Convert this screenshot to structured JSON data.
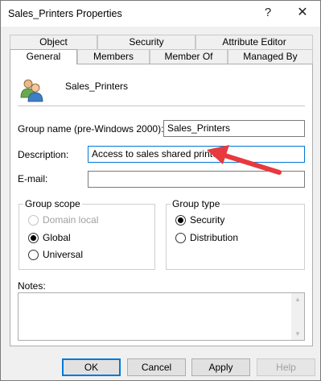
{
  "window": {
    "title": "Sales_Printers Properties",
    "help_glyph": "?",
    "close_glyph": "✕"
  },
  "tabs": {
    "back_row": [
      "Object",
      "Security",
      "Attribute Editor"
    ],
    "front_row": [
      "General",
      "Members",
      "Member Of",
      "Managed By"
    ],
    "active": "General"
  },
  "general": {
    "group_icon": "group-users-icon",
    "group_display_name": "Sales_Printers",
    "group_name_label": "Group name (pre-Windows 2000):",
    "group_name_value": "Sales_Printers",
    "description_label": "Description:",
    "description_value": "Access to sales shared printer",
    "email_label": "E-mail:",
    "email_value": "",
    "group_scope": {
      "legend": "Group scope",
      "options": [
        "Domain local",
        "Global",
        "Universal"
      ],
      "selected": "Global",
      "disabled": [
        "Domain local"
      ]
    },
    "group_type": {
      "legend": "Group type",
      "options": [
        "Security",
        "Distribution"
      ],
      "selected": "Security"
    },
    "notes_label": "Notes:",
    "notes_value": ""
  },
  "buttons": {
    "ok": "OK",
    "cancel": "Cancel",
    "apply": "Apply",
    "help": "Help"
  },
  "annotation": {
    "icon": "red-arrow-pointer",
    "color": "#e8393e"
  }
}
